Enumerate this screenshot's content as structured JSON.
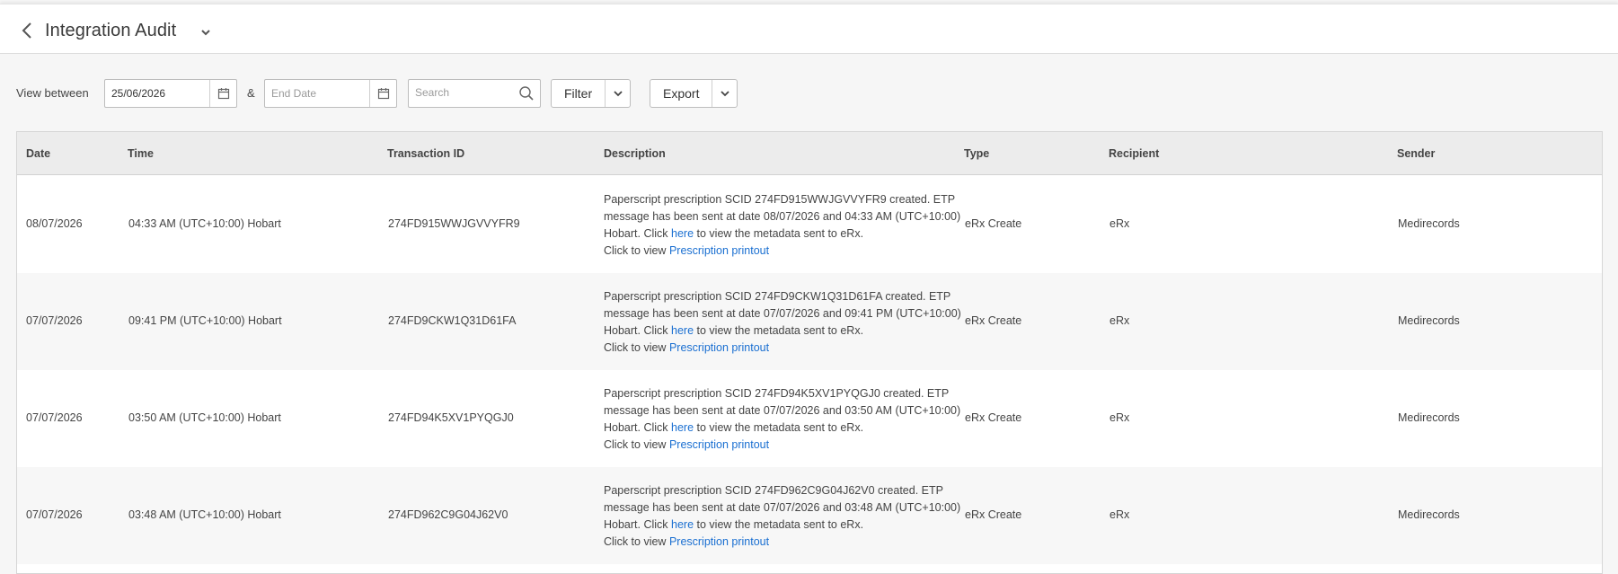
{
  "header": {
    "title": "Integration Audit"
  },
  "toolbar": {
    "view_between_label": "View between",
    "start_date": "25/06/2026",
    "ampersand": "&",
    "end_date_placeholder": "End Date",
    "search_placeholder": "Search",
    "filter_label": "Filter",
    "export_label": "Export"
  },
  "table": {
    "columns": {
      "date": "Date",
      "time": "Time",
      "transaction_id": "Transaction ID",
      "description": "Description",
      "type": "Type",
      "recipient": "Recipient",
      "sender": "Sender"
    },
    "rows": [
      {
        "date": "08/07/2026",
        "time": "04:33 AM (UTC+10:00) Hobart",
        "transaction_id": "274FD915WWJGVVYFR9",
        "desc_main": "Paperscript prescription SCID 274FD915WWJGVVYFR9 created. ETP message has been sent at date 08/07/2026 and 04:33 AM (UTC+10:00) Hobart. Click ",
        "desc_here": "here",
        "desc_after": " to view the metadata sent to eRx.",
        "desc_click": "Click to view ",
        "desc_printout": "Prescription printout",
        "type": "eRx Create",
        "recipient": "eRx",
        "sender": "Medirecords"
      },
      {
        "date": "07/07/2026",
        "time": "09:41 PM (UTC+10:00) Hobart",
        "transaction_id": "274FD9CKW1Q31D61FA",
        "desc_main": "Paperscript prescription SCID 274FD9CKW1Q31D61FA created. ETP message has been sent at date 07/07/2026 and 09:41 PM (UTC+10:00) Hobart. Click ",
        "desc_here": "here",
        "desc_after": " to view the metadata sent to eRx.",
        "desc_click": "Click to view ",
        "desc_printout": "Prescription printout",
        "type": "eRx Create",
        "recipient": "eRx",
        "sender": "Medirecords"
      },
      {
        "date": "07/07/2026",
        "time": "03:50 AM (UTC+10:00) Hobart",
        "transaction_id": "274FD94K5XV1PYQGJ0",
        "desc_main": "Paperscript prescription SCID 274FD94K5XV1PYQGJ0 created. ETP message has been sent at date 07/07/2026 and 03:50 AM (UTC+10:00) Hobart. Click ",
        "desc_here": "here",
        "desc_after": " to view the metadata sent to eRx.",
        "desc_click": "Click to view ",
        "desc_printout": "Prescription printout",
        "type": "eRx Create",
        "recipient": "eRx",
        "sender": "Medirecords"
      },
      {
        "date": "07/07/2026",
        "time": "03:48 AM (UTC+10:00) Hobart",
        "transaction_id": "274FD962C9G04J62V0",
        "desc_main": "Paperscript prescription SCID 274FD962C9G04J62V0 created. ETP message has been sent at date 07/07/2026 and 03:48 AM (UTC+10:00) Hobart. Click ",
        "desc_here": "here",
        "desc_after": " to view the metadata sent to eRx.",
        "desc_click": "Click to view ",
        "desc_printout": "Prescription printout",
        "type": "eRx Create",
        "recipient": "eRx",
        "sender": "Medirecords"
      }
    ]
  },
  "colors": {
    "link": "#1a6fd1",
    "header_bg": "#ececec",
    "alt_row_bg": "#f7f7f7"
  }
}
